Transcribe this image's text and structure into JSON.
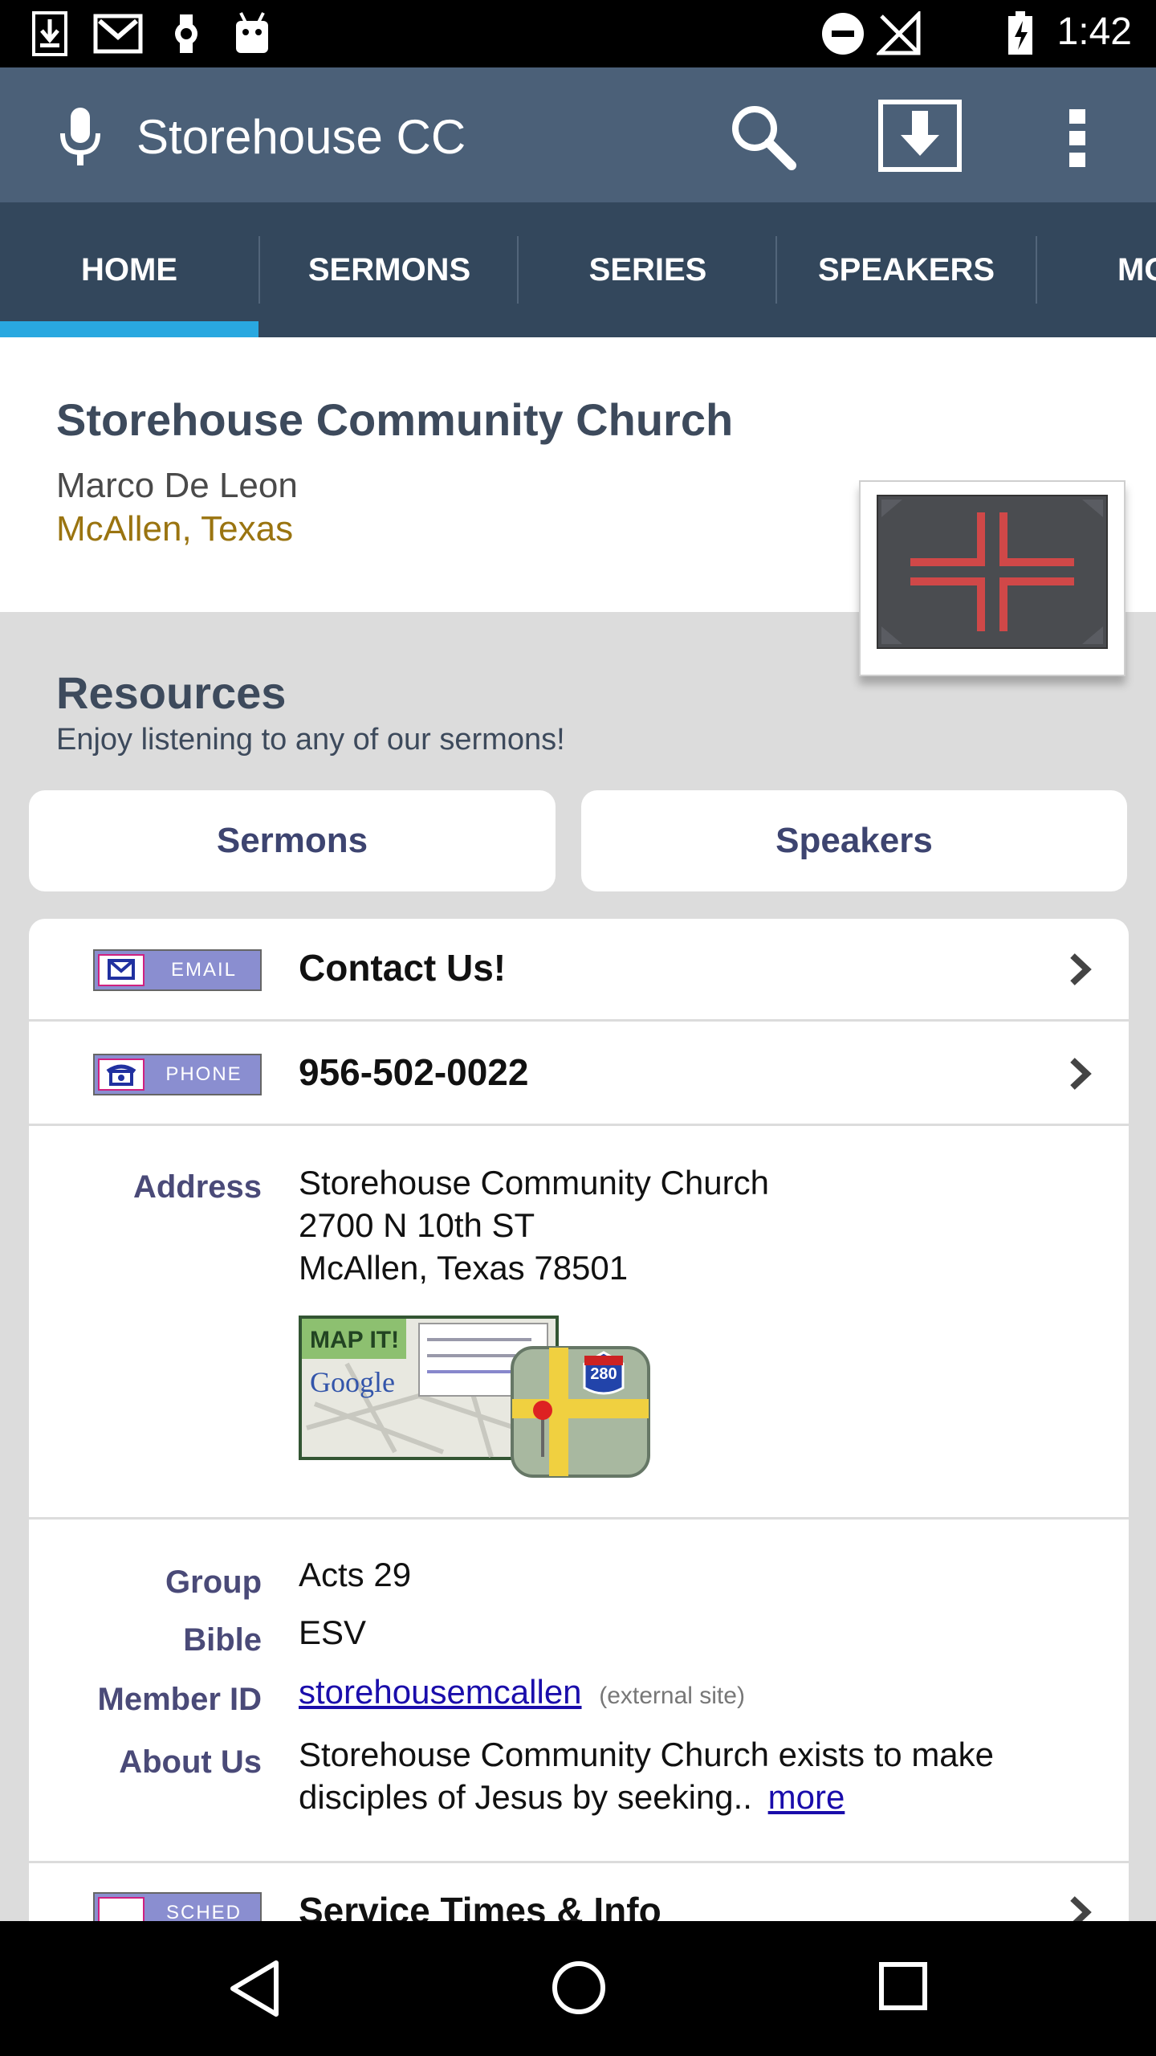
{
  "status_bar": {
    "time": "1:42",
    "icons": [
      "download-icon",
      "gmail-icon",
      "watch-icon",
      "android-icon",
      "dnd-icon",
      "signal-off-icon",
      "battery-icon"
    ]
  },
  "action_bar": {
    "title": "Storehouse CC",
    "icons": [
      "microphone-icon",
      "search-icon",
      "download-icon",
      "overflow-menu-icon"
    ]
  },
  "tabs": [
    {
      "label": "HOME",
      "selected": true
    },
    {
      "label": "SERMONS"
    },
    {
      "label": "SERIES"
    },
    {
      "label": "SPEAKERS"
    },
    {
      "label": "MO"
    }
  ],
  "header": {
    "church_name": "Storehouse Community Church",
    "pastor": "Marco De Leon",
    "location": "McAllen, Texas"
  },
  "resources": {
    "title": "Resources",
    "subtitle": "Enjoy listening to any of our sermons!",
    "buttons": {
      "sermons": "Sermons",
      "speakers": "Speakers"
    }
  },
  "contact": {
    "email_badge": "EMAIL",
    "email_label": "Contact Us!",
    "phone_badge": "PHONE",
    "phone_number": "956-502-0022"
  },
  "address": {
    "label": "Address",
    "line1": "Storehouse Community Church",
    "line2": "2700 N 10th ST",
    "line3": "McAllen, Texas 78501",
    "map_badge": "MAP IT!",
    "map_brand": "Google",
    "road_sign": "280"
  },
  "details": {
    "group_label": "Group",
    "group_value": "Acts 29",
    "bible_label": "Bible",
    "bible_value": "ESV",
    "member_label": "Member ID",
    "member_value": "storehousemcallen",
    "member_note": "(external site)",
    "about_label": "About Us",
    "about_line1": "Storehouse Community Church exists to make",
    "about_line2": "disciples of Jesus by seeking..",
    "about_more": "more"
  },
  "next_row": {
    "badge": "SCHED",
    "label": "Service Times & Info"
  },
  "colors": {
    "action_bar": "#4b6078",
    "tab_bar": "#33475c",
    "tab_indicator": "#29a8e0",
    "location": "#9a7410",
    "label": "#4a4a78"
  }
}
